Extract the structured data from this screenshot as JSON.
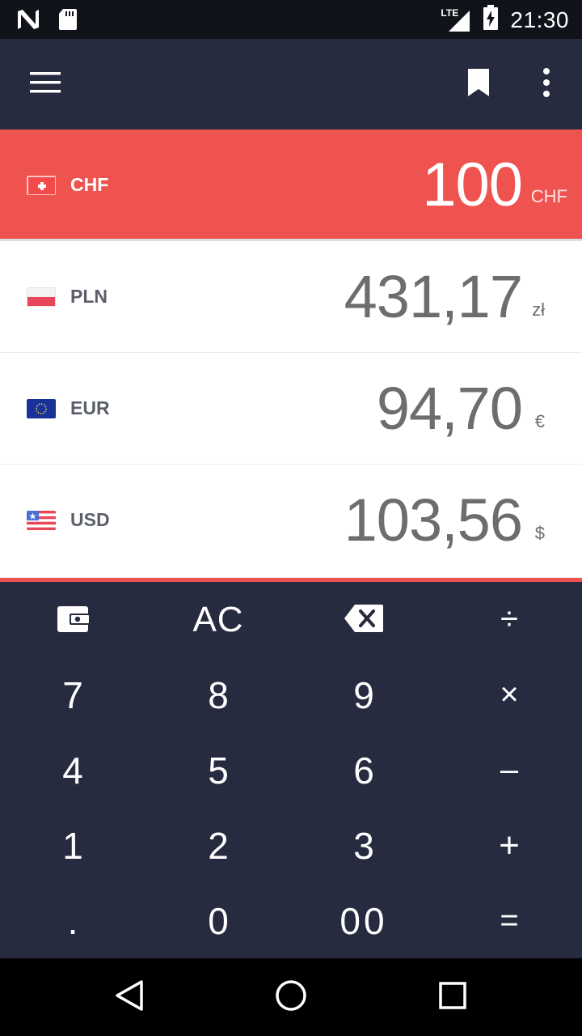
{
  "status_bar": {
    "network": "LTE",
    "time": "21:30"
  },
  "rows": [
    {
      "code": "CHF",
      "amount": "100",
      "unit": "CHF",
      "selected": true
    },
    {
      "code": "PLN",
      "amount": "431,17",
      "unit": "zł",
      "selected": false
    },
    {
      "code": "EUR",
      "amount": "94,70",
      "unit": "€",
      "selected": false
    },
    {
      "code": "USD",
      "amount": "103,56",
      "unit": "$",
      "selected": false
    }
  ],
  "keypad": {
    "ac": "AC",
    "divide": "÷",
    "k7": "7",
    "k8": "8",
    "k9": "9",
    "multiply": "×",
    "k4": "4",
    "k5": "5",
    "k6": "6",
    "minus": "–",
    "k1": "1",
    "k2": "2",
    "k3": "3",
    "plus": "+",
    "dot": ".",
    "k0": "0",
    "k00": "00",
    "equals": "="
  },
  "colors": {
    "accent": "#ef5350",
    "dark": "#262b40",
    "status_bar": "#11131b"
  },
  "icons": [
    "notification-n-icon",
    "sd-card-icon",
    "lte-signal-icon",
    "battery-charging-icon",
    "menu-icon",
    "bookmark-icon",
    "more-vert-icon",
    "wallet-icon",
    "backspace-icon",
    "back-nav-icon",
    "home-nav-icon",
    "recents-nav-icon"
  ]
}
